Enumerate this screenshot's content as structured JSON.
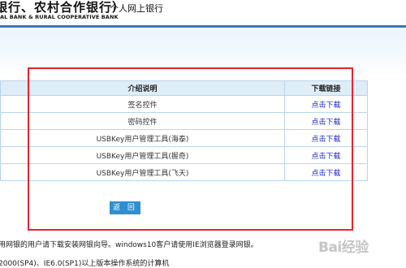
{
  "header": {
    "bank_name": "银行、农村合作银行）",
    "bank_english": "AL BANK & RURAL COOPERATIVE BANK",
    "product_name": "个人网上银行"
  },
  "table": {
    "headers": {
      "desc": "介绍说明",
      "link": "下载链接"
    },
    "rows": [
      {
        "desc": "签名控件",
        "link": "点击下载"
      },
      {
        "desc": "密码控件",
        "link": "点击下载"
      },
      {
        "desc": "USBKey用户管理工具(海泰)",
        "link": "点击下载"
      },
      {
        "desc": "USBKey用户管理工具(握奇)",
        "link": "点击下载"
      },
      {
        "desc": "USBKey用户管理工具(飞天)",
        "link": "点击下载"
      }
    ]
  },
  "back_button": {
    "label": "返 回"
  },
  "notes": {
    "line1": "用网银的用户请下载安装网银向导。windows10客户请使用IE浏览器登录网银。",
    "line2": "2000(SP4)、IE6.0(SP1)以上版本操作系统的计算机"
  },
  "watermark": {
    "text": "Bai经验"
  },
  "colors": {
    "header_band": "#3f74c0",
    "table_header_bg": "#deedf8",
    "table_border": "#b9d5ea",
    "link": "#1a23c8",
    "button_bg": "#2f8fcf",
    "highlight_box": "#e8232f"
  }
}
